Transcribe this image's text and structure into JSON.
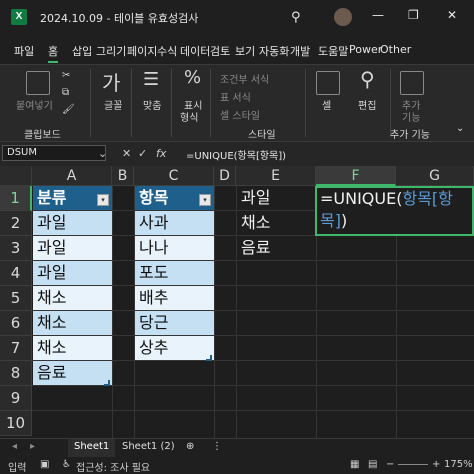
{
  "titlebar": {
    "app_icon": "X",
    "title": "2024.10.09 - 테이블 유효성검사",
    "search_icon": "search-icon"
  },
  "menu": [
    {
      "label": "파일"
    },
    {
      "label": "홈"
    },
    {
      "label": "삽입"
    },
    {
      "label": "그리기"
    },
    {
      "label": "페이지"
    },
    {
      "label": "수식"
    },
    {
      "label": "데이터"
    },
    {
      "label": "검토"
    },
    {
      "label": "보기"
    },
    {
      "label": "자동화"
    },
    {
      "label": "개발"
    },
    {
      "label": "도움말"
    },
    {
      "label": "Power"
    },
    {
      "label": "Other"
    }
  ],
  "ribbon": {
    "clipboard": {
      "paste": "붙여넣기",
      "group": "클립보드"
    },
    "font": {
      "label": "글꼴",
      "glyph": "가"
    },
    "align": {
      "label": "맞춤"
    },
    "number": {
      "label1": "표시",
      "label2": "형식",
      "glyph": "%"
    },
    "styles": {
      "cond": "조건부 서식",
      "table": "표 서식",
      "cell": "셀 스타일",
      "group": "스타일"
    },
    "cells": {
      "label": "셀"
    },
    "edit": {
      "label": "편집"
    },
    "addins": {
      "label1": "추가",
      "label2": "기능",
      "group": "추가 기능"
    }
  },
  "formula_bar": {
    "name_box": "DSUM",
    "cancel": "✕",
    "enter": "✓",
    "fx": "fx",
    "formula": "=UNIQUE(항목[항목])"
  },
  "columns": [
    "A",
    "B",
    "C",
    "D",
    "E",
    "F",
    "G"
  ],
  "rows": [
    "1",
    "2",
    "3",
    "4",
    "5",
    "6",
    "7",
    "8",
    "9",
    "10"
  ],
  "table_bunryu": {
    "header": "분류",
    "values": [
      "과일",
      "과일",
      "과일",
      "채소",
      "채소",
      "채소",
      "음료"
    ]
  },
  "table_hangmok": {
    "header": "항목",
    "values": [
      "사과",
      "나나",
      "포도",
      "배추",
      "당근",
      "상추"
    ]
  },
  "column_e": [
    "과일",
    "채소",
    "음료"
  ],
  "active_cell": {
    "address": "F1",
    "prefix": "=UNIQUE(",
    "ref": "항목[항목]",
    "suffix": ")"
  },
  "sheets": [
    {
      "label": "Sheet1",
      "active": true
    },
    {
      "label": "Sheet1 (2)",
      "active": false
    }
  ],
  "status": {
    "mode": "입력",
    "accessibility": "접근성: 조사 필요",
    "zoom": "175%"
  },
  "colors": {
    "accent": "#3fb86b",
    "table_header": "#1e5f8c",
    "band_dark": "#c5e0f2",
    "band_light": "#e8f3fb",
    "ref": "#5b9bd5"
  }
}
